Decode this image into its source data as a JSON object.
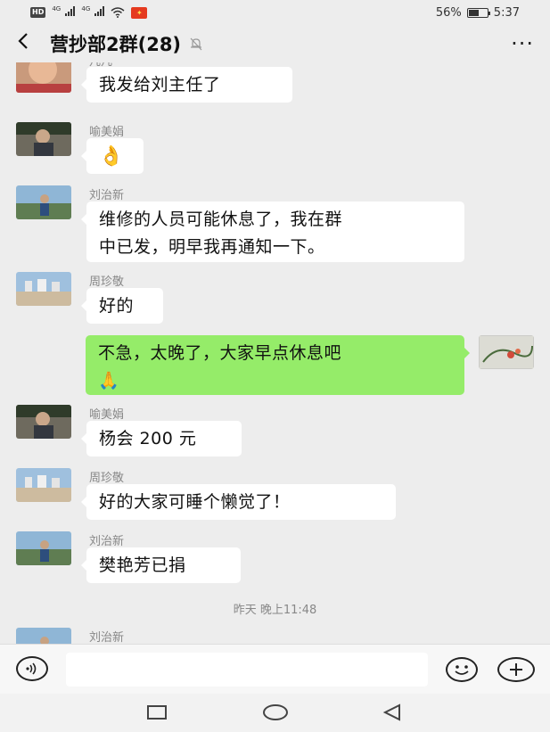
{
  "status_bar": {
    "hd_label": "HD",
    "signal1_label": "4G",
    "signal2_label": "4G",
    "battery_percent": "56%",
    "battery_level": 0.56,
    "time": "5:37"
  },
  "header": {
    "title": "营抄部2群(28)",
    "back_icon": "chevron-left-icon",
    "mute_icon": "bell-off-icon",
    "more_label": "···"
  },
  "messages": [
    {
      "sender": "凡凡",
      "text": "我发给刘主任了"
    },
    {
      "sender": "喻美娟",
      "text": "👌"
    },
    {
      "sender": "刘治新",
      "text_line1": "维修的人员可能休息了，我在群",
      "text_line2": "中已发，明早我再通知一下。"
    },
    {
      "sender": "周珍敬",
      "text": "好的"
    },
    {
      "sender": "me",
      "text_line1": "不急，太晚了，大家早点休息吧",
      "text_line2": "🙏"
    },
    {
      "sender": "喻美娟",
      "text": "杨会 200 元"
    },
    {
      "sender": "周珍敬",
      "text": "好的大家可睡个懒觉了！"
    },
    {
      "sender": "刘治新",
      "text": "樊艳芳已捐"
    },
    {
      "sender": "刘治新"
    }
  ],
  "timestamp": "昨天 晚上11:48",
  "input": {
    "value": "",
    "voice_icon": "voice-icon",
    "emoji_icon": "emoji-icon",
    "plus_icon": "plus-icon"
  },
  "nav": {
    "recent_icon": "square-icon",
    "home_icon": "circle-icon",
    "back_icon": "triangle-back-icon"
  }
}
